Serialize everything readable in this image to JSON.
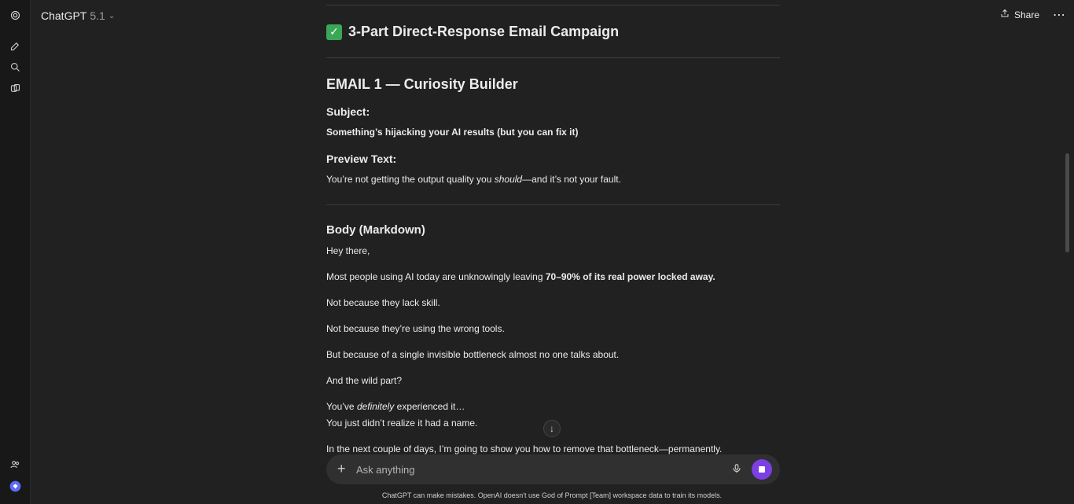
{
  "header": {
    "model_name": "ChatGPT",
    "model_version": "5.1",
    "share_label": "Share",
    "more_label": "⋯"
  },
  "content": {
    "campaign_title": "3-Part Direct-Response Email Campaign",
    "email_title": "EMAIL 1 — Curiosity Builder",
    "subject_label": "Subject:",
    "subject_text": "Something’s hijacking your AI results (but you can fix it)",
    "preview_label": "Preview Text:",
    "preview_text_a": "You’re not getting the output quality you ",
    "preview_text_em": "should",
    "preview_text_b": "—and it’s not your fault.",
    "body_heading": "Body (Markdown)",
    "p1": "Hey there,",
    "p2_a": "Most people using AI today are unknowingly leaving ",
    "p2_b": "70–90% of its real power locked away.",
    "p3": "Not because they lack skill.",
    "p4": "Not because they’re using the wrong tools.",
    "p5": "But because of a single invisible bottleneck almost no one talks about.",
    "p6": "And the wild part?",
    "p7_a": "You’ve ",
    "p7_em": "definitely",
    "p7_b": " experienced it…",
    "p8": "You just didn’t realize it had a name.",
    "p9": "In the next couple of days, I’m going to show you how to remove that bottleneck—permanently."
  },
  "composer": {
    "placeholder": "Ask anything",
    "accent": "#7b3fe4"
  },
  "footer": {
    "text": "ChatGPT can make mistakes. OpenAI doesn't use God of Prompt [Team] workspace data to train its models."
  },
  "icons": [
    "openai-logo-icon",
    "new-chat-icon",
    "search-icon",
    "library-icon",
    "team-icon",
    "upgrade-icon",
    "share-icon",
    "arrow-down-icon",
    "plus-icon",
    "mic-icon",
    "stop-icon"
  ]
}
